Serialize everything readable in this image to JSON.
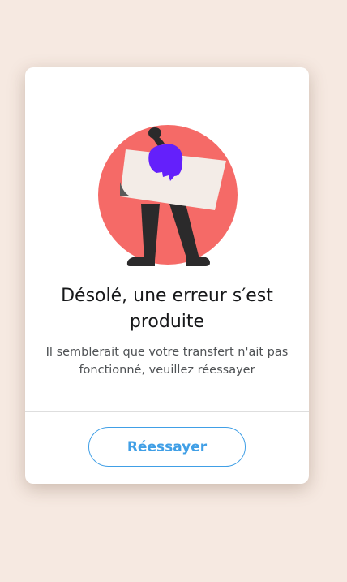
{
  "error_dialog": {
    "title": "Désolé, une erreur s′est produite",
    "message": "Il semblerait que votre transfert n'ait pas fonctionné, veuillez réessayer",
    "retry_label": "Réessayer",
    "illustration": "person-holding-blank-sign-illustration"
  },
  "colors": {
    "page_background": "#f6e9e1",
    "card_background": "#ffffff",
    "circle": "#f56a67",
    "sign": "#f3ece7",
    "hair": "#6420fb",
    "legs": "#2b2a2b",
    "accent": "#409fe6",
    "title_text": "#17181a",
    "body_text": "#4f5255",
    "divider": "#dedede"
  }
}
